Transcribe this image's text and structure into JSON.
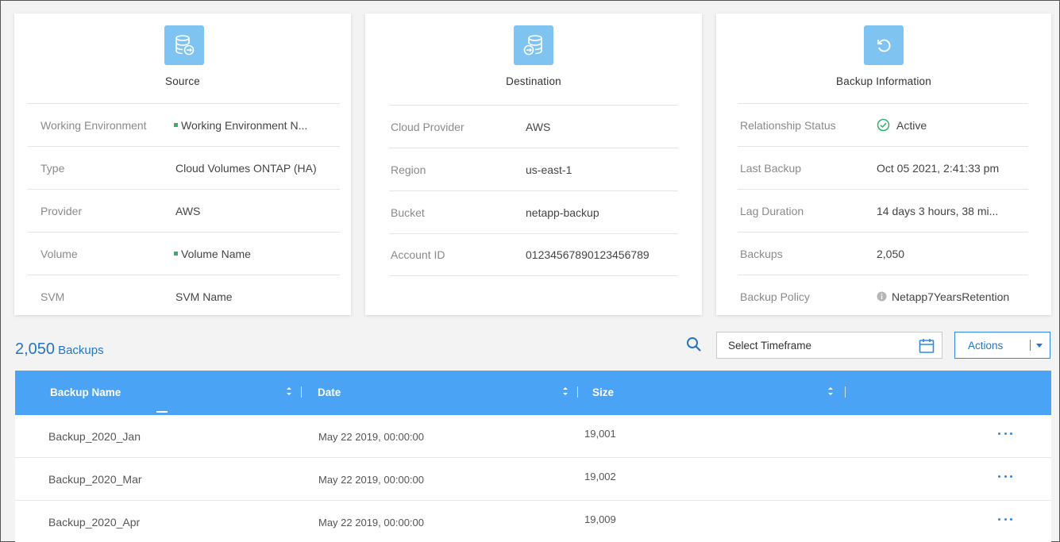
{
  "source": {
    "title": "Source",
    "rows": [
      {
        "label": "Working Environment",
        "value": "Working Environment N...",
        "dot": true
      },
      {
        "label": "Type",
        "value": "Cloud Volumes ONTAP (HA)"
      },
      {
        "label": "Provider",
        "value": "AWS"
      },
      {
        "label": "Volume",
        "value": "Volume Name",
        "dot": true
      },
      {
        "label": "SVM",
        "value": "SVM Name"
      }
    ]
  },
  "destination": {
    "title": "Destination",
    "rows": [
      {
        "label": "Cloud Provider",
        "value": "AWS"
      },
      {
        "label": "Region",
        "value": "us-east-1"
      },
      {
        "label": "Bucket",
        "value": "netapp-backup"
      },
      {
        "label": "Account ID",
        "value": "01234567890123456789"
      }
    ]
  },
  "backup_info": {
    "title": "Backup Information",
    "rows": [
      {
        "label": "Relationship Status",
        "value": "Active"
      },
      {
        "label": "Last Backup",
        "value": "Oct 05 2021, 2:41:33 pm"
      },
      {
        "label": "Lag Duration",
        "value": "14 days 3 hours, 38 mi..."
      },
      {
        "label": "Backups",
        "value": "2,050"
      },
      {
        "label": "Backup Policy",
        "value": "Netapp7YearsRetention"
      }
    ]
  },
  "toolbar": {
    "count": "2,050",
    "count_label": "Backups",
    "timeframe_placeholder": "Select Timeframe",
    "actions_label": "Actions"
  },
  "table": {
    "columns": [
      "Backup Name",
      "Date",
      "Size"
    ],
    "rows": [
      {
        "name": "Backup_2020_Jan",
        "date": "May 22 2019, 00:00:00",
        "size": "19,001"
      },
      {
        "name": "Backup_2020_Mar",
        "date": "May 22 2019, 00:00:00",
        "size": "19,002"
      },
      {
        "name": "Backup_2020_Apr",
        "date": "May 22 2019, 00:00:00",
        "size": "19,009"
      }
    ]
  },
  "colors": {
    "accent": "#2b8ae0",
    "header_bg": "#4aa3f5",
    "icon_bg": "#7fc3f0",
    "status_green": "#2fb36a"
  }
}
